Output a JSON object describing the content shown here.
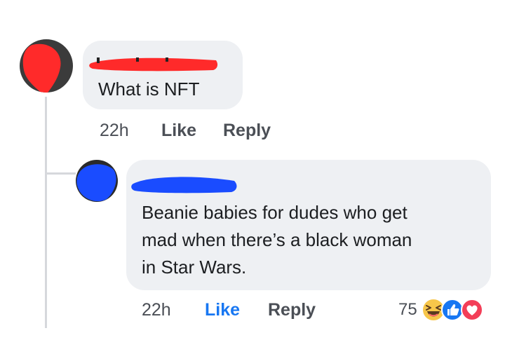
{
  "comments": [
    {
      "author_redacted": true,
      "text": "What is NFT",
      "time": "22h",
      "like_label": "Like",
      "reply_label": "Reply"
    },
    {
      "author_redacted": true,
      "text_lines": [
        "Beanie babies for dudes who get",
        "mad when there’s a black woman",
        "in Star Wars."
      ],
      "time": "22h",
      "like_label": "Like",
      "reply_label": "Reply",
      "liked": true,
      "reaction_count": "75",
      "reaction_icons": [
        "haha-icon",
        "like-icon",
        "love-icon"
      ]
    }
  ],
  "colors": {
    "bubble": "#eef0f3",
    "thread_line": "#d6d8dc",
    "meta_text": "#4b4f56",
    "liked_blue": "#1877f2",
    "redaction_red": "#ff2a2a",
    "redaction_blue": "#1a4cff"
  }
}
